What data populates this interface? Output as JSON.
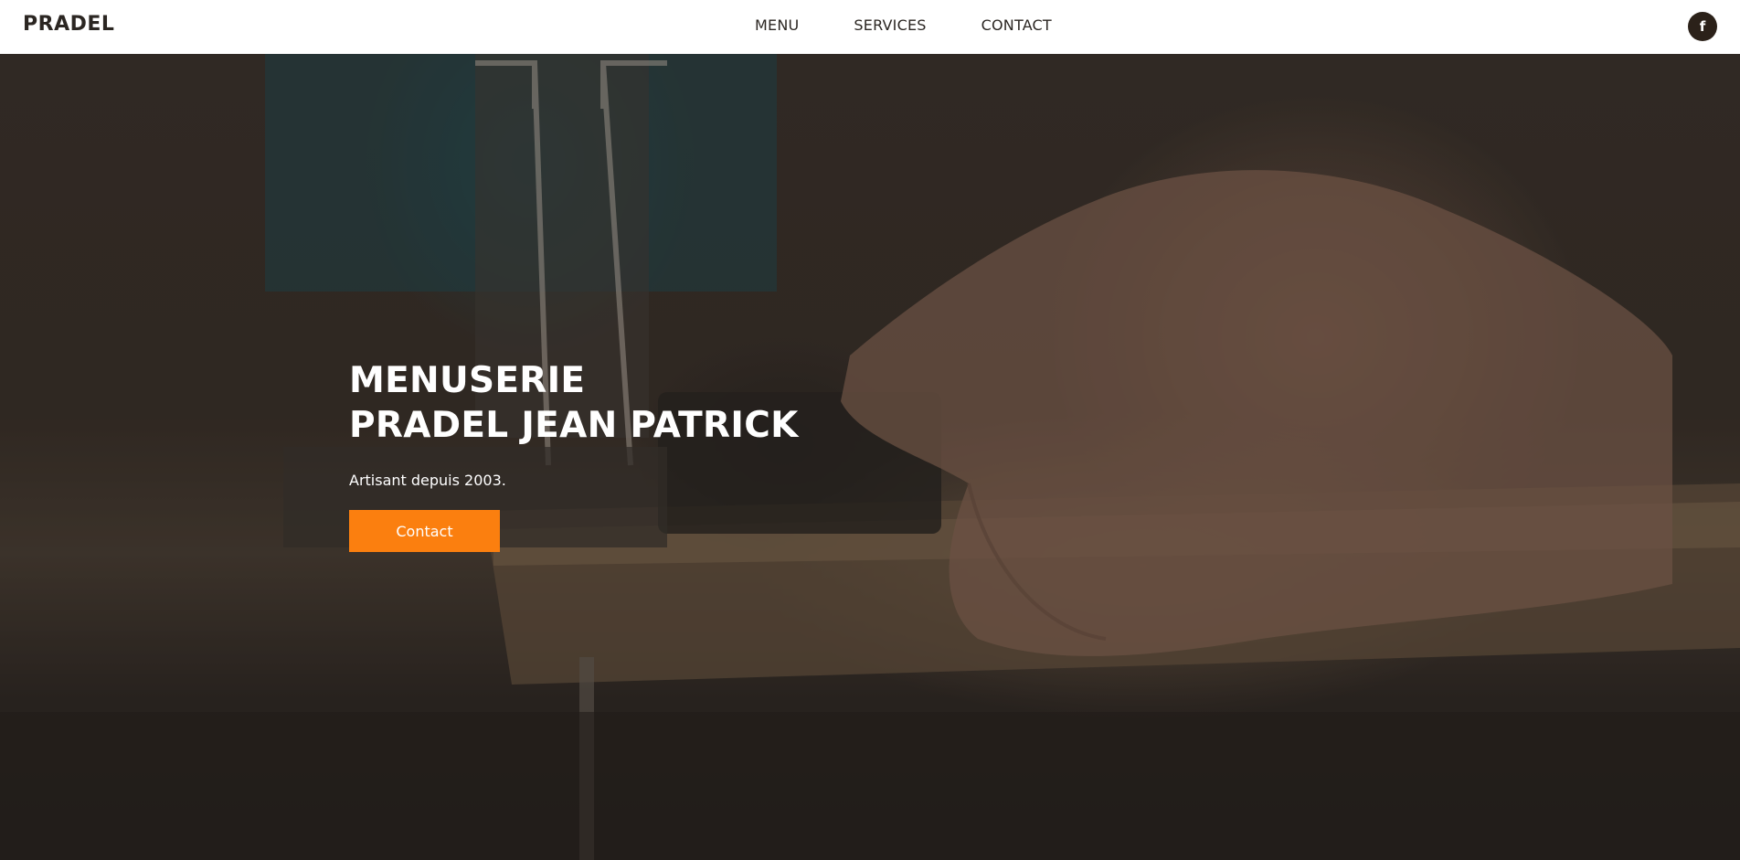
{
  "header": {
    "logo": "PRADEL",
    "nav": [
      "MENU",
      "SERVICES",
      "CONTACT"
    ],
    "social_icon": "facebook-icon",
    "social_glyph": "f"
  },
  "hero": {
    "title_line1": "MENUSERIE",
    "title_line2": "PRADEL JEAN PATRICK",
    "subtitle": "Artisant depuis 2003.",
    "cta_label": "Contact"
  },
  "colors": {
    "accent": "#fb7f0f",
    "dark": "#2b2119",
    "nav_bg": "#ffffff"
  }
}
